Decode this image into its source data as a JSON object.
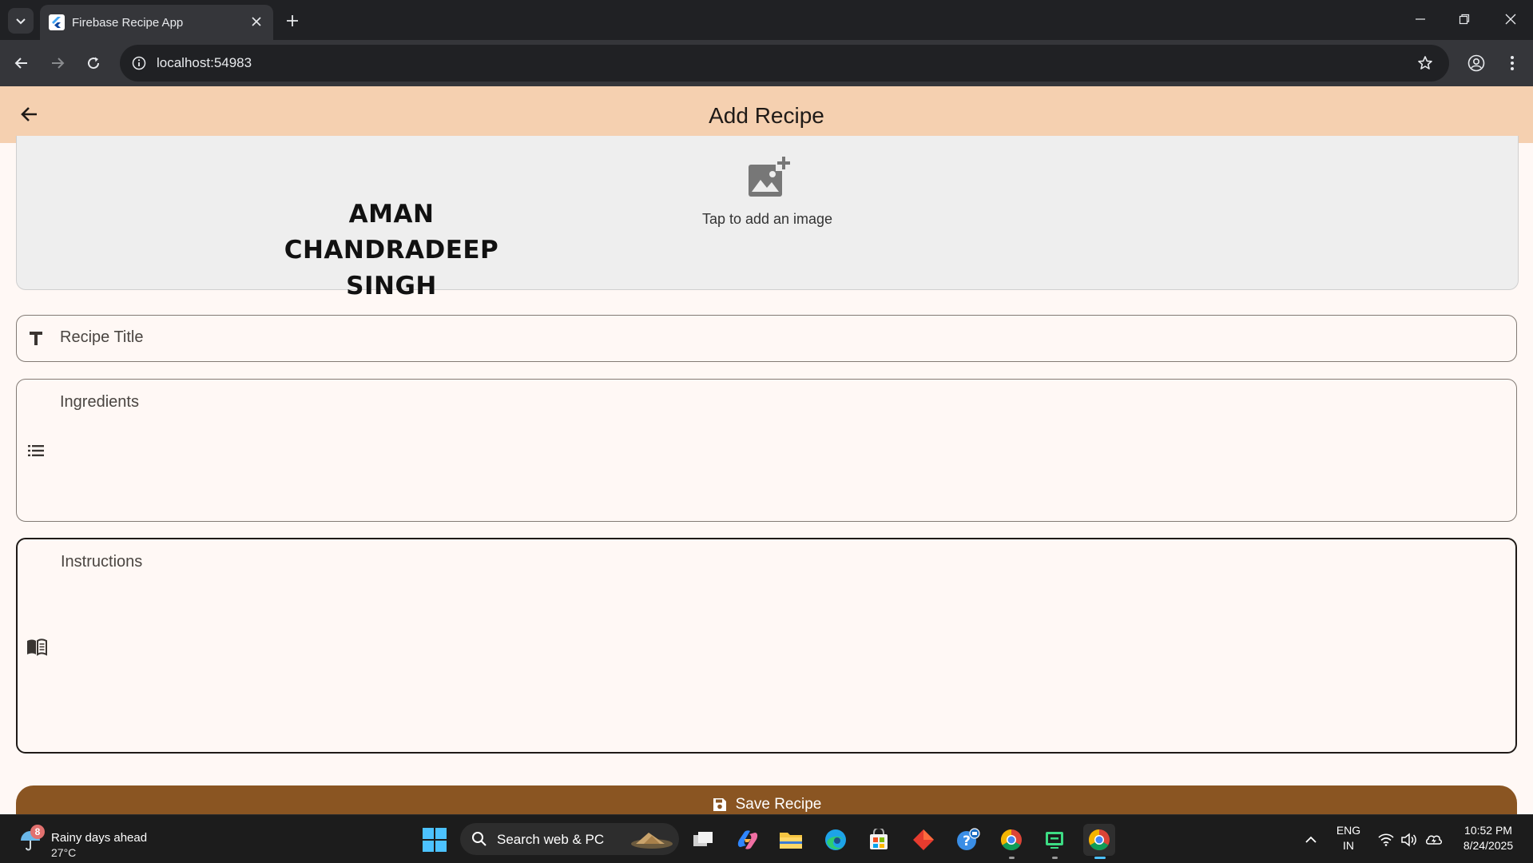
{
  "browser": {
    "tab_title": "Firebase Recipe App",
    "url": "localhost:54983"
  },
  "appbar": {
    "title": "Add Recipe"
  },
  "image_picker": {
    "hint": "Tap to add an image",
    "watermark_lines": [
      "AMAN",
      "CHANDRADEEP",
      "SINGH"
    ]
  },
  "form": {
    "title_label": "Recipe Title",
    "ingredients_label": "Ingredients",
    "instructions_label": "Instructions",
    "save_label": "Save Recipe"
  },
  "colors": {
    "appbar_bg": "#f5d0b0",
    "save_button_bg": "#8a5522",
    "page_bg": "#fff8f5"
  },
  "taskbar": {
    "weather_badge": "8",
    "weather_text": "Rainy days ahead",
    "temperature": "27°C",
    "search_text": "Search web & PC",
    "lang_line1": "ENG",
    "lang_line2": "IN",
    "time": "10:52 PM",
    "date": "8/24/2025"
  }
}
